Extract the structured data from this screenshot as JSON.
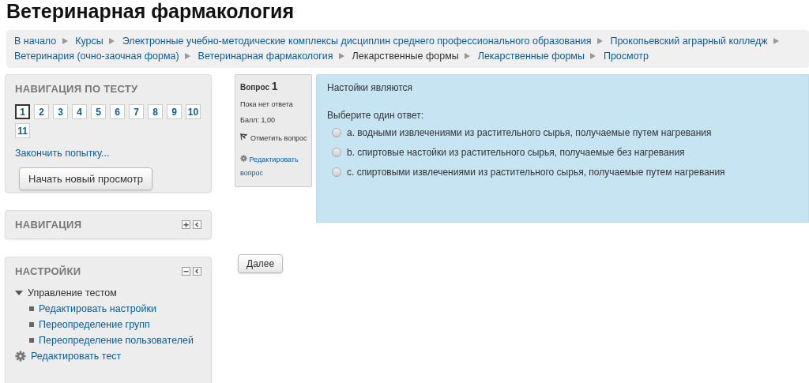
{
  "page_title": "Ветеринарная фармакология",
  "breadcrumb": [
    {
      "label": "В начало",
      "kind": "link"
    },
    {
      "label": "Курсы",
      "kind": "link"
    },
    {
      "label": "Электронные учебно-методические комплексы дисциплин среднего профессионального образования",
      "kind": "link"
    },
    {
      "label": "Прокопьевский аграрный колледж",
      "kind": "link"
    },
    {
      "label": "Ветеринария (очно-заочная форма)",
      "kind": "link"
    },
    {
      "label": "Ветеринарная фармакология",
      "kind": "link"
    },
    {
      "label": "Лекарственные формы",
      "kind": "text"
    },
    {
      "label": "Лекарственные формы",
      "kind": "link"
    },
    {
      "label": "Просмотр",
      "kind": "link"
    }
  ],
  "quiz_navigation": {
    "title": "НАВИГАЦИЯ ПО ТЕСТУ",
    "questions": [
      {
        "label": "1",
        "selected": true
      },
      {
        "label": "2",
        "selected": false
      },
      {
        "label": "3",
        "selected": false
      },
      {
        "label": "4",
        "selected": false
      },
      {
        "label": "5",
        "selected": false
      },
      {
        "label": "6",
        "selected": false
      },
      {
        "label": "7",
        "selected": false
      },
      {
        "label": "8",
        "selected": false
      },
      {
        "label": "9",
        "selected": false
      },
      {
        "label": "10",
        "selected": false
      },
      {
        "label": "11",
        "selected": false
      }
    ],
    "finish_link": "Закончить попытку...",
    "restart_button": "Начать новый просмотр"
  },
  "navigation_block": {
    "title": "НАВИГАЦИЯ",
    "collapsed": true
  },
  "settings_block": {
    "title": "НАСТРОЙКИ",
    "collapsed": false,
    "tree": [
      {
        "label": "Управление тестом",
        "kind": "branch",
        "expanded": true,
        "children": [
          {
            "label": "Редактировать настройки",
            "kind": "leaf"
          },
          {
            "label": "Переопределение групп",
            "kind": "leaf"
          },
          {
            "label": "Переопределение пользователей",
            "kind": "leaf"
          }
        ]
      },
      {
        "label": "Редактировать тест",
        "kind": "gear"
      }
    ]
  },
  "question_info": {
    "heading": "Вопрос",
    "number": "1",
    "status": "Пока нет ответа",
    "grade": "Балл: 1,00",
    "flag_link": "Отметить вопрос",
    "edit_link": "Редактировать вопрос"
  },
  "question": {
    "text": "Настойки являются",
    "prompt": "Выберите один ответ:",
    "options": [
      {
        "label": "a. водными извлечениями из растительного сырья, получаемые путем нагревания",
        "checked": false
      },
      {
        "label": "b. спиртовые настойки из растительного сырья, получаемые без нагревания",
        "checked": false
      },
      {
        "label": "c. спиртовыми извлечениями из растительного сырья, получаемые путем нагревания",
        "checked": false
      }
    ]
  },
  "next_button": "Далее"
}
